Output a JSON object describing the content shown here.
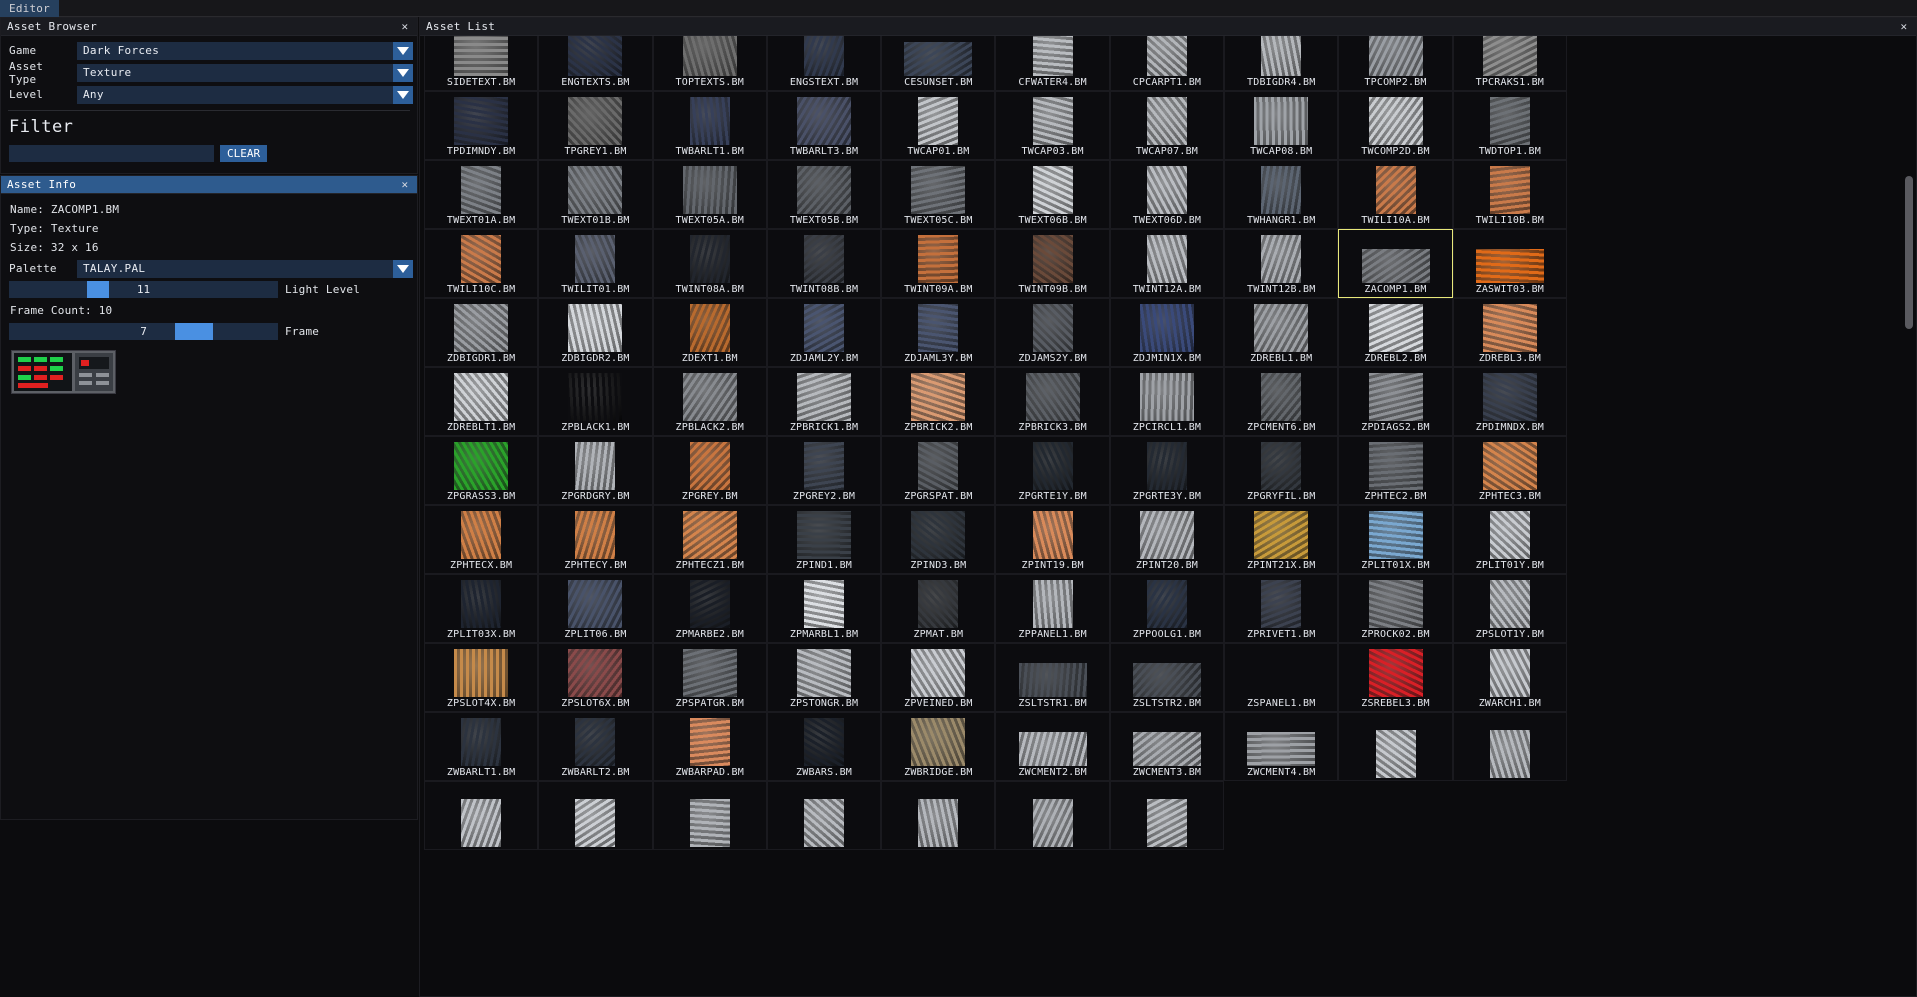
{
  "menubar": {
    "items": [
      "Editor"
    ]
  },
  "asset_browser": {
    "title": "Asset Browser",
    "close_glyph": "✕",
    "fields": [
      {
        "label": "Game",
        "value": "Dark Forces"
      },
      {
        "label": "Asset Type",
        "value": "Texture"
      },
      {
        "label": "Level",
        "value": "Any"
      }
    ],
    "filter_heading": "Filter",
    "filter_value": "",
    "filter_placeholder": "",
    "clear_label": "CLEAR"
  },
  "asset_info": {
    "title": "Asset Info",
    "close_glyph": "✕",
    "name_line": "Name: ZACOMP1.BM",
    "type_line": "Type: Texture",
    "size_line": "Size: 32 x 16",
    "palette_label": "Palette",
    "palette_value": "TALAY.PAL",
    "light_level": {
      "value": "11",
      "caption": "Light Level",
      "percent": 33
    },
    "frame_count_line": "Frame Count: 10",
    "frame": {
      "value": "7",
      "caption": "Frame",
      "percent": 70
    }
  },
  "asset_list": {
    "title": "Asset List",
    "close_glyph": "✕",
    "selected": "ZACOMP1.BM",
    "scroll_percent": 17,
    "items": [
      {
        "n": "SIDETEXT.BM",
        "c": "#8a8a8a",
        "k": "sq",
        "partial": true
      },
      {
        "n": "ENGTEXTS.BM",
        "c": "#2b3347",
        "k": "sq",
        "partial": true
      },
      {
        "n": "TOPTEXTS.BM",
        "c": "#6e6e6e",
        "k": "sq",
        "partial": true
      },
      {
        "n": "ENGSTEXT.BM",
        "c": "#313a4e",
        "k": "tall",
        "partial": true
      },
      {
        "n": "CESUNSET.BM",
        "c": "#3c4658",
        "k": "wide",
        "partial": true
      },
      {
        "n": "CFWATER4.BM",
        "c": "#b9bcc0",
        "k": "tall",
        "partial": true
      },
      {
        "n": "CPCARPT1.BM",
        "c": "#b2b5b9",
        "k": "tall",
        "partial": true
      },
      {
        "n": "TDBIGDR4.BM",
        "c": "#b4b7bb",
        "k": "tall",
        "partial": true
      },
      {
        "n": "TPCOMP2.BM",
        "c": "#9a9ea4",
        "k": "sq",
        "partial": true
      },
      {
        "n": "TPCRAKS1.BM",
        "c": "#8e8e8e",
        "k": "sq"
      },
      {
        "n": "TPDIMNDY.BM",
        "c": "#2a3145",
        "k": "sq"
      },
      {
        "n": "TPGREY1.BM",
        "c": "#6a6a6a",
        "k": "sq"
      },
      {
        "n": "TWBARLT1.BM",
        "c": "#37405a",
        "k": "tall"
      },
      {
        "n": "TWBARLT3.BM",
        "c": "#4a5168",
        "k": "sq"
      },
      {
        "n": "TWCAP01.BM",
        "c": "#c2c5c9",
        "k": "tall"
      },
      {
        "n": "TWCAP03.BM",
        "c": "#b6b9bd",
        "k": "tall"
      },
      {
        "n": "TWCAP07.BM",
        "c": "#b6b9bd",
        "k": "tall"
      },
      {
        "n": "TWCAP08.BM",
        "c": "#9fa3a8",
        "k": "sq"
      },
      {
        "n": "TWCOMP2D.BM",
        "c": "#c9ccd0",
        "k": "sq"
      },
      {
        "n": "TWDTOP1.BM",
        "c": "#6d7176",
        "k": "tall"
      },
      {
        "n": "TWEXT01A.BM",
        "c": "#7d8187",
        "k": "tall"
      },
      {
        "n": "TWEXT01B.BM",
        "c": "#7a7e84",
        "k": "sq"
      },
      {
        "n": "TWEXT05A.BM",
        "c": "#63676d",
        "k": "sq"
      },
      {
        "n": "TWEXT05B.BM",
        "c": "#5c6066",
        "k": "sq"
      },
      {
        "n": "TWEXT05C.BM",
        "c": "#6e7278",
        "k": "sq"
      },
      {
        "n": "TWEXT06B.BM",
        "c": "#cfd2d6",
        "k": "tall"
      },
      {
        "n": "TWEXT06D.BM",
        "c": "#babdc2",
        "k": "tall"
      },
      {
        "n": "TWHANGR1.BM",
        "c": "#5c6572",
        "k": "tall"
      },
      {
        "n": "TWILI10A.BM",
        "c": "#c97a4a",
        "k": "tall"
      },
      {
        "n": "TWILI10B.BM",
        "c": "#c97a4a",
        "k": "tall"
      },
      {
        "n": "TWILI10C.BM",
        "c": "#c97a4a",
        "k": "tall"
      },
      {
        "n": "TWILIT01.BM",
        "c": "#5a6070",
        "k": "tall"
      },
      {
        "n": "TWINT08A.BM",
        "c": "#22262e",
        "k": "tall"
      },
      {
        "n": "TWINT08B.BM",
        "c": "#3a3e46",
        "k": "tall"
      },
      {
        "n": "TWINT09A.BM",
        "c": "#c4703c",
        "k": "tall"
      },
      {
        "n": "TWINT09B.BM",
        "c": "#6a4a3a",
        "k": "tall"
      },
      {
        "n": "TWINT12A.BM",
        "c": "#b9bcc1",
        "k": "tall"
      },
      {
        "n": "TWINT12B.BM",
        "c": "#a9acb1",
        "k": "tall"
      },
      {
        "n": "ZACOMP1.BM",
        "c": "#7a7d82",
        "k": "wide"
      },
      {
        "n": "ZASWIT03.BM",
        "c": "#e06a18",
        "k": "wide"
      },
      {
        "n": "ZDBIGDR1.BM",
        "c": "#9a9da2",
        "k": "sq"
      },
      {
        "n": "ZDBIGDR2.BM",
        "c": "#d4d7db",
        "k": "sq"
      },
      {
        "n": "ZDEXT1.BM",
        "c": "#b86a2e",
        "k": "tall"
      },
      {
        "n": "ZDJAML2Y.BM",
        "c": "#4a5570",
        "k": "tall"
      },
      {
        "n": "ZDJAML3Y.BM",
        "c": "#4a5570",
        "k": "tall"
      },
      {
        "n": "ZDJAMS2Y.BM",
        "c": "#585c63",
        "k": "tall"
      },
      {
        "n": "ZDJMIN1X.BM",
        "c": "#3a4a7a",
        "k": "sq"
      },
      {
        "n": "ZDREBL1.BM",
        "c": "#9da0a5",
        "k": "sq"
      },
      {
        "n": "ZDREBL2.BM",
        "c": "#d6d9dd",
        "k": "sq"
      },
      {
        "n": "ZDREBL3.BM",
        "c": "#d88a5a",
        "k": "sq"
      },
      {
        "n": "ZDREBLT1.BM",
        "c": "#cfd2d6",
        "k": "sq"
      },
      {
        "n": "ZPBLACK1.BM",
        "c": "#0d0d10",
        "k": "sq"
      },
      {
        "n": "ZPBLACK2.BM",
        "c": "#888b90",
        "k": "sq"
      },
      {
        "n": "ZPBRICK1.BM",
        "c": "#b6b9bd",
        "k": "sq"
      },
      {
        "n": "ZPBRICK2.BM",
        "c": "#d99a72",
        "k": "sq"
      },
      {
        "n": "ZPBRICK3.BM",
        "c": "#5c6066",
        "k": "sq"
      },
      {
        "n": "ZPCIRCL1.BM",
        "c": "#9fa2a7",
        "k": "sq"
      },
      {
        "n": "ZPCMENT6.BM",
        "c": "#63676c",
        "k": "tall"
      },
      {
        "n": "ZPDIAGS2.BM",
        "c": "#8e9196",
        "k": "sq"
      },
      {
        "n": "ZPDIMNDX.BM",
        "c": "#39404f",
        "k": "sq"
      },
      {
        "n": "ZPGRASS3.BM",
        "c": "#2aa22a",
        "k": "sq"
      },
      {
        "n": "ZPGRDGRY.BM",
        "c": "#b0b3b8",
        "k": "tall"
      },
      {
        "n": "ZPGREY.BM",
        "c": "#c8753f",
        "k": "tall"
      },
      {
        "n": "ZPGREY2.BM",
        "c": "#3e4552",
        "k": "tall"
      },
      {
        "n": "ZPGRSPAT.BM",
        "c": "#5a5e64",
        "k": "tall"
      },
      {
        "n": "ZPGRTE1Y.BM",
        "c": "#222830",
        "k": "tall"
      },
      {
        "n": "ZPGRTE3Y.BM",
        "c": "#242a33",
        "k": "tall"
      },
      {
        "n": "ZPGRYFIL.BM",
        "c": "#33383f",
        "k": "tall"
      },
      {
        "n": "ZPHTEC2.BM",
        "c": "#6a6e74",
        "k": "sq"
      },
      {
        "n": "ZPHTEC3.BM",
        "c": "#d4844c",
        "k": "sq"
      },
      {
        "n": "ZPHTECX.BM",
        "c": "#cf7f46",
        "k": "tall"
      },
      {
        "n": "ZPHTECY.BM",
        "c": "#cf7f46",
        "k": "tall"
      },
      {
        "n": "ZPHTECZ1.BM",
        "c": "#d4844c",
        "k": "sq"
      },
      {
        "n": "ZPIND1.BM",
        "c": "#3a4048",
        "k": "sq"
      },
      {
        "n": "ZPIND3.BM",
        "c": "#2e343c",
        "k": "sq"
      },
      {
        "n": "ZPINT19.BM",
        "c": "#d88a5a",
        "k": "tall"
      },
      {
        "n": "ZPINT20.BM",
        "c": "#b4b7bc",
        "k": "sq"
      },
      {
        "n": "ZPINT21X.BM",
        "c": "#c79a3a",
        "k": "sq"
      },
      {
        "n": "ZPLIT01X.BM",
        "c": "#7aa8d0",
        "k": "sq"
      },
      {
        "n": "ZPLIT01Y.BM",
        "c": "#c8cbd0",
        "k": "tall"
      },
      {
        "n": "ZPLIT03X.BM",
        "c": "#1e2430",
        "k": "tall"
      },
      {
        "n": "ZPLIT06.BM",
        "c": "#49536a",
        "k": "sq"
      },
      {
        "n": "ZPMARBE2.BM",
        "c": "#1a1e26",
        "k": "tall"
      },
      {
        "n": "ZPMARBL1.BM",
        "c": "#dcdfe3",
        "k": "tall"
      },
      {
        "n": "ZPMAT.BM",
        "c": "#36393e",
        "k": "tall"
      },
      {
        "n": "ZPPANEL1.BM",
        "c": "#b4b7bc",
        "k": "tall"
      },
      {
        "n": "ZPPOOLG1.BM",
        "c": "#2a3344",
        "k": "tall"
      },
      {
        "n": "ZPRIVET1.BM",
        "c": "#3c4250",
        "k": "tall"
      },
      {
        "n": "ZPROCK02.BM",
        "c": "#7c7f84",
        "k": "sq"
      },
      {
        "n": "ZPSLOT1Y.BM",
        "c": "#b8bbc0",
        "k": "tall"
      },
      {
        "n": "ZPSLOT4X.BM",
        "c": "#c58a4a",
        "k": "sq"
      },
      {
        "n": "ZPSLOT6X.BM",
        "c": "#8a4a4a",
        "k": "sq"
      },
      {
        "n": "ZPSPATGR.BM",
        "c": "#6c7076",
        "k": "sq"
      },
      {
        "n": "ZPSTONGR.BM",
        "c": "#b8bbc0",
        "k": "sq"
      },
      {
        "n": "ZPVEINED.BM",
        "c": "#c9ccd1",
        "k": "sq"
      },
      {
        "n": "ZSLTSTR1.BM",
        "c": "#4a4f57",
        "k": "wide"
      },
      {
        "n": "ZSLTSTR2.BM",
        "c": "#4a4f57",
        "k": "wide"
      },
      {
        "n": "ZSPANEL1.BM",
        "c": "#2e3banonymous",
        "k": "tall"
      },
      {
        "n": "ZSREBEL3.BM",
        "c": "#d81f26",
        "k": "sq"
      },
      {
        "n": "ZWARCH1.BM",
        "c": "#c6c9ce",
        "k": "tall"
      },
      {
        "n": "ZWBARLT1.BM",
        "c": "#2c333f",
        "k": "tall"
      },
      {
        "n": "ZWBARLT2.BM",
        "c": "#2c333f",
        "k": "tall"
      },
      {
        "n": "ZWBARPAD.BM",
        "c": "#d98a5e",
        "k": "tall"
      },
      {
        "n": "ZWBARS.BM",
        "c": "#1b2029",
        "k": "tall"
      },
      {
        "n": "ZWBRIDGE.BM",
        "c": "#9b8a6a",
        "k": "sq"
      },
      {
        "n": "ZWCMENT2.BM",
        "c": "#b6b9be",
        "k": "wide"
      },
      {
        "n": "ZWCMENT3.BM",
        "c": "#a8abb0",
        "k": "wide"
      },
      {
        "n": "ZWCMENT4.BM",
        "c": "#9ea1a6",
        "k": "wide"
      },
      {
        "n": "",
        "c": "#c6c9ce",
        "k": "tall",
        "partial": true
      },
      {
        "n": "",
        "c": "#b6b9be",
        "k": "tall",
        "partial": true
      },
      {
        "n": "",
        "c": "#c0c3c8",
        "k": "tall",
        "partial": true
      },
      {
        "n": "",
        "c": "#cccfd4",
        "k": "tall",
        "partial": true
      },
      {
        "n": "",
        "c": "#b0b3b8",
        "k": "tall",
        "partial": true
      },
      {
        "n": "",
        "c": "#b8bbc0",
        "k": "tall",
        "partial": true
      },
      {
        "n": "",
        "c": "#b4b7bc",
        "k": "tall",
        "partial": true
      },
      {
        "n": "",
        "c": "#aeb1b6",
        "k": "tall",
        "partial": true
      },
      {
        "n": "",
        "c": "#babdc2",
        "k": "tall",
        "partial": true
      }
    ]
  }
}
